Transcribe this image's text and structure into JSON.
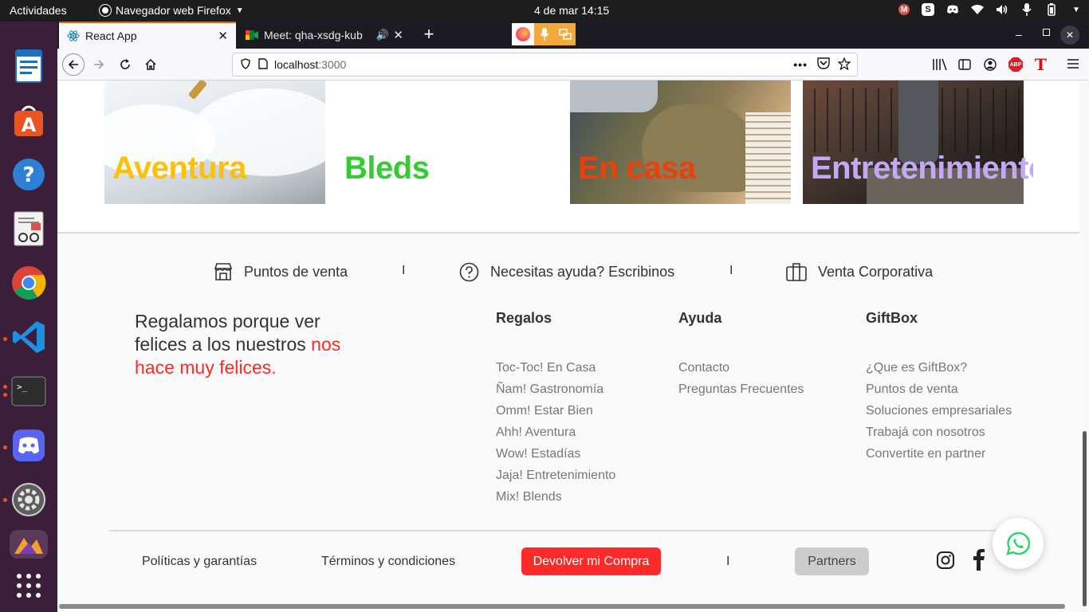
{
  "topbar": {
    "activities": "Actividades",
    "app_name": "Navegador web Firefox",
    "clock": "4 de mar  14:15"
  },
  "tabs": [
    {
      "label": "React App"
    },
    {
      "label": "Meet: qha-xsdg-kub"
    }
  ],
  "url": {
    "host": "localhost",
    "port": ":3000"
  },
  "cards": [
    {
      "title": "Aventura",
      "color": "#ffc107"
    },
    {
      "title": "Bleds",
      "color": "#33cc33"
    },
    {
      "title": "En casa",
      "color": "#e8410e"
    },
    {
      "title": "Entretenimiento",
      "color": "#c3a9f5"
    }
  ],
  "footer": {
    "links": {
      "puntos": "Puntos de venta",
      "ayuda": "Necesitas ayuda? Escribinos",
      "corporativa": "Venta Corporativa",
      "sep": "I"
    },
    "slogan": {
      "line1": "Regalamos porque ver felices a los nuestros",
      "line2": "nos hace muy felices.",
      "accent": "#ff2b2b"
    },
    "columns": {
      "regalos": {
        "title": "Regalos",
        "items": [
          "Toc-Toc! En Casa",
          "Ñam! Gastronomía",
          "Omm! Estar Bien",
          "Ahh! Aventura",
          "Wow! Estadías",
          "Jaja! Entretenimiento",
          "Mix! Blends"
        ]
      },
      "ayuda": {
        "title": "Ayuda",
        "items": [
          "Contacto",
          "Preguntas Frecuentes"
        ]
      },
      "giftbox": {
        "title": "GiftBox",
        "items": [
          "¿Que es GiftBox?",
          "Puntos de venta",
          "Soluciones empresariales",
          "Trabajá con nosotros",
          "Convertite en partner"
        ]
      }
    },
    "bottom": {
      "politicas": "Políticas y garantías",
      "terminos": "Términos y condiciones",
      "devolver": "Devolver mi Compra",
      "sep": "I",
      "partners": "Partners"
    }
  }
}
